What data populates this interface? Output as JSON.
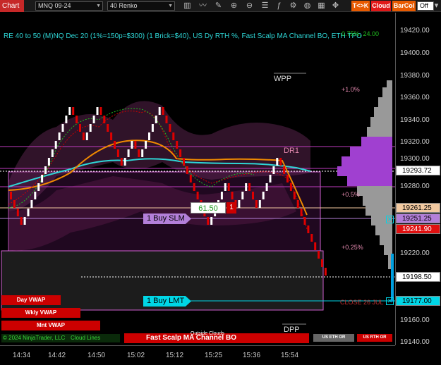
{
  "toolbar": {
    "chart_label": "Chart",
    "instrument": "MNQ 09-24",
    "bar_type": "40 Renko",
    "icons": [
      "bar-style-icon",
      "line-style-icon",
      "draw-icon",
      "zoom-in-icon",
      "zoom-out-icon",
      "properties-icon",
      "strategies-icon",
      "indicators-icon",
      "share-icon",
      "calendar-icon",
      "tools-icon",
      "grid-icon",
      "split-icon"
    ],
    "t_k_label": "T<>K",
    "cloud_label": "Cloud",
    "barcol_label": "BarCol",
    "off_label": "Off"
  },
  "chart": {
    "title": "RE 40 to 50 (M)NQ Dec 20 (1%=150p=$300) (1 Brick=$40), US Dy RTH %, Fast Scalp MA Channel BO, ETH TPO",
    "overlap_text": "0.75%, 24.00",
    "levels": {
      "wpp": "WPP",
      "dr1": "DR1",
      "dpp": "DPP",
      "close_label": "CLOSE 26 JUL"
    },
    "pct_labels": [
      "+1.0%",
      "+0.5%",
      "+0.25%"
    ],
    "buy_slm": "1 Buy SLM",
    "buy_lmt": "1 Buy LMT",
    "order_price": "61.50",
    "order_qty": "1",
    "outside_clouds": "Outside Clouds",
    "fast_scalp_label": "Fast Scalp MA Channel BO",
    "copyright": "© 2024 NinjaTrader, LLC",
    "cloud_lines_label": "Cloud Lines"
  },
  "legend": [
    "Day VWAP",
    "Wkly VWAP",
    "Mnt VWAP"
  ],
  "small_buttons": [
    "US ETH OR",
    "US RTH OR"
  ],
  "price_axis": {
    "ticks": [
      "19420.00",
      "19400.00",
      "19380.00",
      "19360.00",
      "19340.00",
      "19320.00",
      "19300.00",
      "19280.00",
      "19220.00",
      "19160.00",
      "19140.00"
    ],
    "badges": [
      {
        "label": "19293.72",
        "bg": "#ffffff",
        "fg": "#000000"
      },
      {
        "label": "19261.25",
        "bg": "#f2c9a0",
        "fg": "#000000"
      },
      {
        "label": "19251.25",
        "bg": "#b37fd9",
        "fg": "#000000"
      },
      {
        "label": "19241.90",
        "bg": "#e01010",
        "fg": "#ffffff"
      },
      {
        "label": "19198.50",
        "bg": "#ffffff",
        "fg": "#000000"
      },
      {
        "label": "19177.00",
        "bg": "#00d6e6",
        "fg": "#000000"
      }
    ]
  },
  "time_axis": [
    "14:34",
    "14:42",
    "14:50",
    "15:02",
    "15:12",
    "15:25",
    "15:36",
    "15:54"
  ],
  "colors": {
    "up_brick": "#ffffff",
    "down_brick": "#e00000",
    "cyan": "#2ed6d6",
    "orange": "#f08a00",
    "magenta": "#c03cc0",
    "purple_profile": "#a040d0",
    "gray_profile": "#999999"
  }
}
